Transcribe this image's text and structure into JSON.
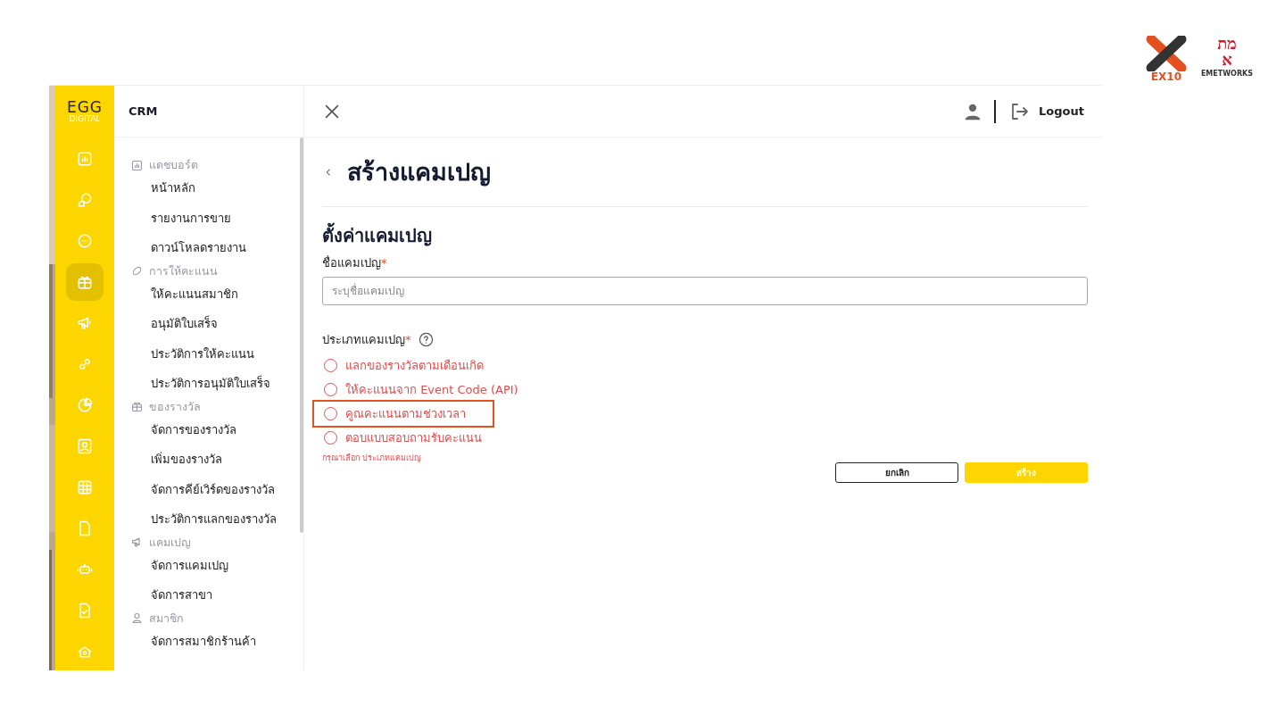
{
  "logos": {
    "ex10": "EX10",
    "emet_top": "מת",
    "emet_bottom": "א",
    "emet_caption": "EMETWORKS"
  },
  "brand": {
    "top": "EGG",
    "bottom": "DIGITAL"
  },
  "rail": [
    {
      "selected": false
    },
    {
      "selected": false
    },
    {
      "selected": false
    },
    {
      "selected": true
    },
    {
      "selected": false
    },
    {
      "selected": false
    },
    {
      "selected": false
    },
    {
      "selected": false
    },
    {
      "selected": false
    },
    {
      "selected": false
    },
    {
      "selected": false
    },
    {
      "selected": false
    },
    {
      "selected": false
    }
  ],
  "menu_title": "CRM",
  "menu": [
    {
      "label": "แดชบอร์ด",
      "children": [
        {
          "label": "หน้าหลัก"
        },
        {
          "label": "รายงานการขาย"
        },
        {
          "label": "ดาวน์โหลดรายงาน"
        }
      ]
    },
    {
      "label": "การให้คะแนน",
      "children": [
        {
          "label": "ให้คะแนนสมาชิก"
        },
        {
          "label": "อนุมัติใบเสร็จ"
        },
        {
          "label": "ประวัติการให้คะแนน"
        },
        {
          "label": "ประวัติการอนุมัติใบเสร็จ"
        }
      ]
    },
    {
      "label": "ของรางวัล",
      "children": [
        {
          "label": "จัดการของรางวัล"
        },
        {
          "label": "เพิ่มของรางวัล"
        },
        {
          "label": "จัดการคีย์เวิร์ดของรางวัล"
        },
        {
          "label": "ประวัติการแลกของรางวัล"
        }
      ]
    },
    {
      "label": "แคมเปญ",
      "children": [
        {
          "label": "จัดการแคมเปญ"
        },
        {
          "label": "จัดการสาขา"
        }
      ]
    },
    {
      "label": "สมาชิก",
      "children": [
        {
          "label": "จัดการสมาชิกร้านค้า"
        }
      ]
    }
  ],
  "topbar": {
    "logout": "Logout"
  },
  "page_title": "สร้างแคมเปญ",
  "section_title": "ตั้งค่าแคมเปญ",
  "name_field": {
    "label": "ชื่อแคมเปญ",
    "required": "*",
    "placeholder": "ระบุชื่อแคมเปญ"
  },
  "type_field": {
    "label": "ประเภทแคมเปญ",
    "required": "*",
    "error": "กรุณาเลือก ประเภทแคมเปญ",
    "options": [
      {
        "label": "แลกของรางวัลตามเดือนเกิด",
        "selected": false,
        "highlighted": false
      },
      {
        "label": "ให้คะแนนจาก Event Code (API)",
        "selected": false,
        "highlighted": false
      },
      {
        "label": "คูณคะแนนตามช่วงเวลา",
        "selected": false,
        "highlighted": true
      },
      {
        "label": "ตอบแบบสอบถามรับคะแนน",
        "selected": false,
        "highlighted": false
      }
    ]
  },
  "buttons": {
    "cancel": "ยกเลิก",
    "create": "สร้าง"
  }
}
